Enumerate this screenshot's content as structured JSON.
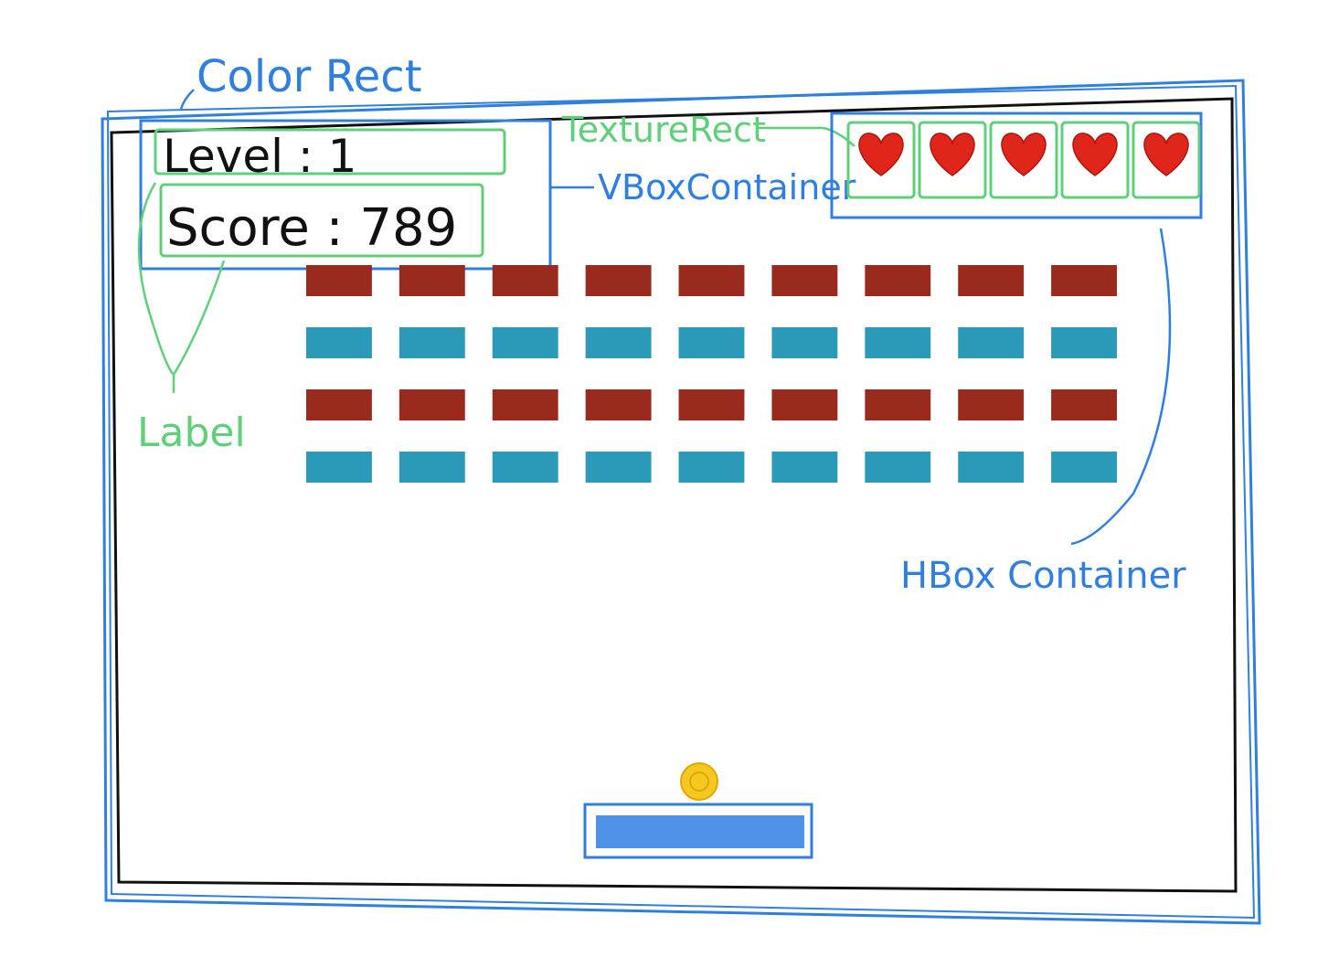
{
  "annotations": {
    "color_rect": "Color Rect",
    "texture_rect": "TextureRect",
    "vbox_container": "VBoxContainer",
    "hbox_container": "HBox Container",
    "label": "Label"
  },
  "hud": {
    "level_text": "Level : 1",
    "score_text": "Score : 789",
    "lives": 5
  },
  "bricks": {
    "rows": 4,
    "columns": 9,
    "row_colors": [
      "#9a2a1e",
      "#2a9ab8",
      "#9a2a1e",
      "#2a9ab8"
    ]
  },
  "colors": {
    "annotation_blue": "#2f7fe0",
    "annotation_green": "#5fd07a",
    "ink_black": "#111111",
    "heart_red": "#e0261a",
    "ball_yellow": "#f4c820",
    "paddle_blue": "#2f7fe0"
  },
  "icons": {
    "life": "heart-icon"
  }
}
